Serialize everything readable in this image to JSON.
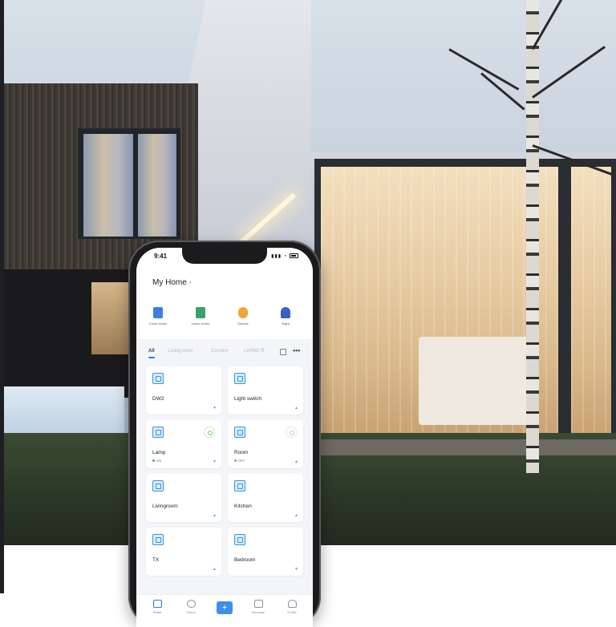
{
  "status_bar": {
    "time": "9:41"
  },
  "header": {
    "home_name": "My Home",
    "chevron": "›"
  },
  "scenes": [
    {
      "label": "Come Home",
      "icon": "door-open-icon",
      "color": "#3d7fe0"
    },
    {
      "label": "Leave Home",
      "icon": "door-exit-icon",
      "color": "#3aa36a"
    },
    {
      "label": "Sunrise",
      "icon": "cloud-sun-icon",
      "color": "#f1a43a"
    },
    {
      "label": "Night",
      "icon": "person-sleep-icon",
      "color": "#3b5fc8"
    }
  ],
  "room_tabs": [
    "All",
    "Living room",
    "Corridor",
    "LIVING R"
  ],
  "devices": [
    {
      "name": "DW2",
      "state": "",
      "arrow": "▼"
    },
    {
      "name": "Light switch",
      "state": "",
      "arrow": "▲"
    },
    {
      "name": "Lamp",
      "state": "ON",
      "arrow": "▼"
    },
    {
      "name": "Room",
      "state": "OFF",
      "arrow": "▲"
    },
    {
      "name": "Livingroom",
      "state": "",
      "arrow": "▲"
    },
    {
      "name": "Kitchen",
      "state": "",
      "arrow": "▲"
    },
    {
      "name": "TX",
      "state": "",
      "arrow": "▲"
    },
    {
      "name": "Bedroom",
      "state": "",
      "arrow": "▼"
    }
  ],
  "bottom_nav": [
    {
      "label": "Home",
      "icon": "home-icon",
      "active": true
    },
    {
      "label": "Scene",
      "icon": "scene-icon",
      "active": false
    },
    {
      "label": "",
      "icon": "add-icon",
      "active": false
    },
    {
      "label": "Message",
      "icon": "message-icon",
      "active": false
    },
    {
      "label": "Profile",
      "icon": "profile-icon",
      "active": false
    }
  ],
  "colors": {
    "accent": "#2c73ff",
    "on": "#4caf50",
    "off": "#9aa0a8"
  }
}
